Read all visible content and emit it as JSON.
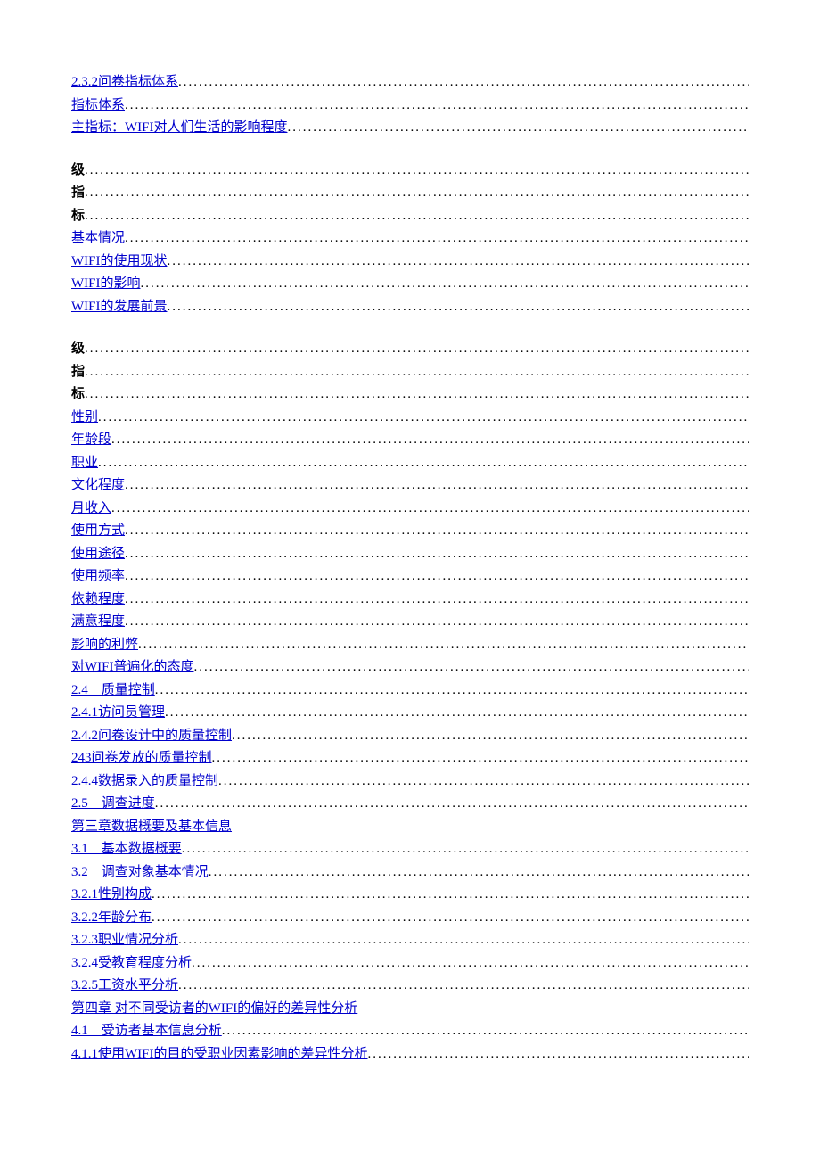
{
  "toc": [
    {
      "label": "2.3.2问卷指标体系",
      "link": true,
      "leader": true
    },
    {
      "label": "指标体系",
      "link": true,
      "leader": true
    },
    {
      "label": "主指标：WIFI对人们生活的影响程度",
      "link": true,
      "leader": true
    },
    {
      "spacer": true
    },
    {
      "label": "级",
      "link": false,
      "leader": true
    },
    {
      "label": "指",
      "link": false,
      "leader": true
    },
    {
      "label": "标",
      "link": false,
      "leader": true
    },
    {
      "label": "基本情况",
      "link": true,
      "leader": true
    },
    {
      "label": "WIFI的使用现状",
      "link": true,
      "leader": true
    },
    {
      "label": "WIFI的影响",
      "link": true,
      "leader": true
    },
    {
      "label": "WIFI的发展前景",
      "link": true,
      "leader": true
    },
    {
      "spacer": true
    },
    {
      "label": "级",
      "link": false,
      "leader": true
    },
    {
      "label": "指",
      "link": false,
      "leader": true
    },
    {
      "label": "标",
      "link": false,
      "leader": true
    },
    {
      "label": "性别",
      "link": true,
      "leader": true
    },
    {
      "label": "年龄段",
      "link": true,
      "leader": true
    },
    {
      "label": "职业",
      "link": true,
      "leader": true
    },
    {
      "label": "文化程度",
      "link": true,
      "leader": true
    },
    {
      "label": "月收入",
      "link": true,
      "leader": true
    },
    {
      "label": "使用方式",
      "link": true,
      "leader": true
    },
    {
      "label": "使用途径",
      "link": true,
      "leader": true
    },
    {
      "label": "使用频率",
      "link": true,
      "leader": true
    },
    {
      "label": "依赖程度",
      "link": true,
      "leader": true
    },
    {
      "label": "满意程度",
      "link": true,
      "leader": true
    },
    {
      "label": "影响的利弊",
      "link": true,
      "leader": true
    },
    {
      "label": "对WIFI普遍化的态度",
      "link": true,
      "leader": true
    },
    {
      "label": "2.4　质量控制",
      "link": true,
      "leader": true
    },
    {
      "label": "2.4.1访问员管理",
      "link": true,
      "leader": true
    },
    {
      "label": "2.4.2问卷设计中的质量控制",
      "link": true,
      "leader": true
    },
    {
      "label": "243问卷发放的质量控制",
      "link": true,
      "leader": true
    },
    {
      "label": "2.4.4数据录入的质量控制",
      "link": true,
      "leader": true
    },
    {
      "label": "2.5　调查进度",
      "link": true,
      "leader": true
    },
    {
      "label": "第三章数据概要及基本信息",
      "link": true,
      "leader": false
    },
    {
      "label": "3.1　基本数据概要",
      "link": true,
      "leader": true
    },
    {
      "label": "3.2　调查对象基本情况",
      "link": true,
      "leader": true
    },
    {
      "label": "3.2.1性别构成",
      "link": true,
      "leader": true
    },
    {
      "label": "3.2.2年龄分布",
      "link": true,
      "leader": true
    },
    {
      "label": "3.2.3职业情况分析",
      "link": true,
      "leader": true
    },
    {
      "label": "3.2.4受教育程度分析",
      "link": true,
      "leader": true
    },
    {
      "label": "3.2.5工资水平分析",
      "link": true,
      "leader": true
    },
    {
      "label": "第四章 对不同受访者的WIFI的偏好的差异性分析",
      "link": true,
      "leader": false
    },
    {
      "label": "4.1　受访者基本信息分析",
      "link": true,
      "leader": true
    },
    {
      "label": "4.1.1使用WIFI的目的受职业因素影响的差异性分析",
      "link": true,
      "leader": true
    }
  ]
}
